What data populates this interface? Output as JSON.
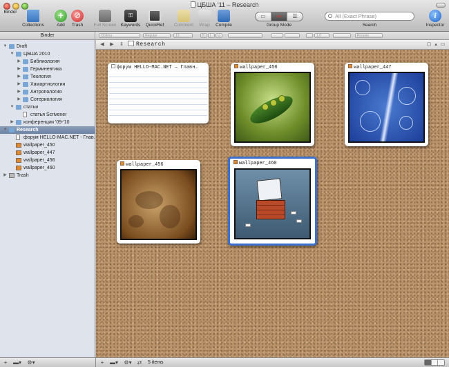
{
  "window": {
    "title": "ЦБША '11 – Research"
  },
  "toolbar": {
    "binder": "Binder",
    "collections": "Collections",
    "add": "Add",
    "trash": "Trash",
    "full_screen": "Full Screen",
    "keywords": "Keywords",
    "quickref": "QuickRef",
    "comment": "Comment",
    "wrap": "Wrap",
    "compile": "Compile",
    "group_mode": "Group Mode",
    "search_placeholder": "All (Exact Phrase)",
    "search_label": "Search",
    "inspector": "Inspector"
  },
  "formatbar": {
    "binder_header": "Binder",
    "font": "Optima",
    "style": "Regular",
    "size": "13",
    "bold": "B",
    "italic": "I",
    "underline": "U",
    "line_spacing": "1.0",
    "presets": "Presets"
  },
  "binder": {
    "items": [
      {
        "label": "Draft",
        "kind": "folder",
        "level": 0,
        "expanded": true
      },
      {
        "label": "ЦБША 2010",
        "kind": "folder",
        "level": 1,
        "expanded": true
      },
      {
        "label": "Библиология",
        "kind": "folder",
        "level": 2,
        "expanded": false
      },
      {
        "label": "Герминевтика",
        "kind": "folder",
        "level": 2,
        "expanded": false
      },
      {
        "label": "Теология",
        "kind": "folder",
        "level": 2,
        "expanded": false
      },
      {
        "label": "Хамартиология",
        "kind": "folder",
        "level": 2,
        "expanded": false
      },
      {
        "label": "Антропология",
        "kind": "folder",
        "level": 2,
        "expanded": false
      },
      {
        "label": "Сотериология",
        "kind": "folder",
        "level": 2,
        "expanded": false
      },
      {
        "label": "статьи",
        "kind": "folder",
        "level": 1,
        "expanded": true
      },
      {
        "label": "статья Scrivener",
        "kind": "doc",
        "level": 2
      },
      {
        "label": "конференции '09-'10",
        "kind": "folder",
        "level": 1,
        "expanded": false
      },
      {
        "label": "Research",
        "kind": "folder",
        "level": 0,
        "expanded": true,
        "selected": true
      },
      {
        "label": "форум HELLO-MAC.NET - Глав…",
        "kind": "doc",
        "level": 1
      },
      {
        "label": "wallpaper_450",
        "kind": "image",
        "level": 1
      },
      {
        "label": "wallpaper_447",
        "kind": "image",
        "level": 1
      },
      {
        "label": "wallpaper_456",
        "kind": "image",
        "level": 1
      },
      {
        "label": "wallpaper_460",
        "kind": "image",
        "level": 1
      },
      {
        "label": "Trash",
        "kind": "trash",
        "level": 0,
        "expanded": false
      }
    ]
  },
  "editor": {
    "header_title": "Research",
    "cards": [
      {
        "title": "форум HELLO-MAC.NET – Главн…",
        "kind": "doc"
      },
      {
        "title": "wallpaper_450",
        "kind": "image"
      },
      {
        "title": "wallpaper_447",
        "kind": "image"
      },
      {
        "title": "wallpaper_456",
        "kind": "image"
      },
      {
        "title": "wallpaper_460",
        "kind": "image",
        "selected": true
      }
    ],
    "footer_count": "5 items"
  },
  "colors": {
    "selection": "#3b6fd0",
    "binder_bg": "#dfe4ec",
    "cork": "#b9926a"
  }
}
